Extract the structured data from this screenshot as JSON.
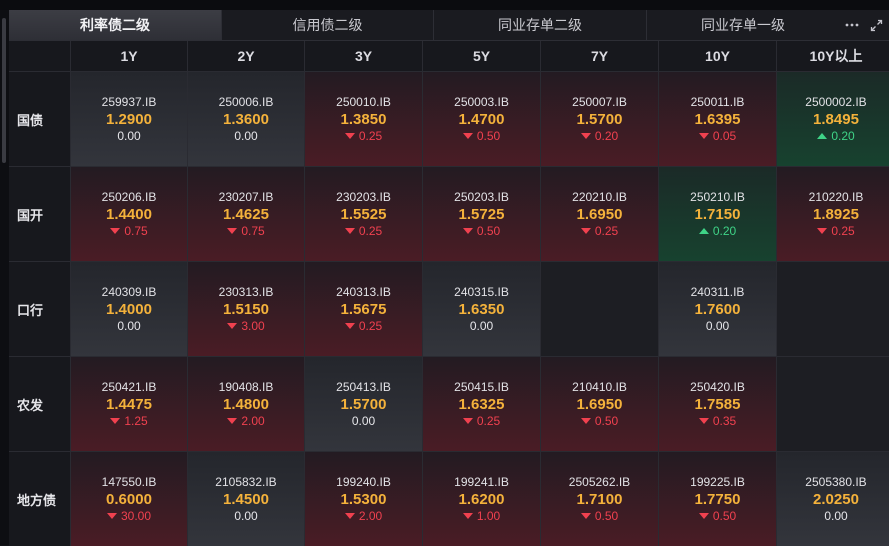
{
  "tabs": [
    "利率债二级",
    "信用债二级",
    "同业存单二级",
    "同业存单一级"
  ],
  "active_tab": 0,
  "icons": [
    "more-icon",
    "expand-icon"
  ],
  "columns": [
    "1Y",
    "2Y",
    "3Y",
    "5Y",
    "7Y",
    "10Y",
    "10Y以上"
  ],
  "rows": [
    {
      "label": "国债",
      "cells": [
        {
          "code": "259937.IB",
          "yield": "1.2900",
          "change": "0.00",
          "dir": "flat"
        },
        {
          "code": "250006.IB",
          "yield": "1.3600",
          "change": "0.00",
          "dir": "flat"
        },
        {
          "code": "250010.IB",
          "yield": "1.3850",
          "change": "0.25",
          "dir": "down"
        },
        {
          "code": "250003.IB",
          "yield": "1.4700",
          "change": "0.50",
          "dir": "down"
        },
        {
          "code": "250007.IB",
          "yield": "1.5700",
          "change": "0.20",
          "dir": "down"
        },
        {
          "code": "250011.IB",
          "yield": "1.6395",
          "change": "0.05",
          "dir": "down"
        },
        {
          "code": "2500002.IB",
          "yield": "1.8495",
          "change": "0.20",
          "dir": "up"
        }
      ]
    },
    {
      "label": "国开",
      "cells": [
        {
          "code": "250206.IB",
          "yield": "1.4400",
          "change": "0.75",
          "dir": "down"
        },
        {
          "code": "230207.IB",
          "yield": "1.4625",
          "change": "0.75",
          "dir": "down"
        },
        {
          "code": "230203.IB",
          "yield": "1.5525",
          "change": "0.25",
          "dir": "down"
        },
        {
          "code": "250203.IB",
          "yield": "1.5725",
          "change": "0.50",
          "dir": "down"
        },
        {
          "code": "220210.IB",
          "yield": "1.6950",
          "change": "0.25",
          "dir": "down"
        },
        {
          "code": "250210.IB",
          "yield": "1.7150",
          "change": "0.20",
          "dir": "up"
        },
        {
          "code": "210220.IB",
          "yield": "1.8925",
          "change": "0.25",
          "dir": "down"
        }
      ]
    },
    {
      "label": "口行",
      "cells": [
        {
          "code": "240309.IB",
          "yield": "1.4000",
          "change": "0.00",
          "dir": "flat"
        },
        {
          "code": "230313.IB",
          "yield": "1.5150",
          "change": "3.00",
          "dir": "down"
        },
        {
          "code": "240313.IB",
          "yield": "1.5675",
          "change": "0.25",
          "dir": "down"
        },
        {
          "code": "240315.IB",
          "yield": "1.6350",
          "change": "0.00",
          "dir": "flat"
        },
        null,
        {
          "code": "240311.IB",
          "yield": "1.7600",
          "change": "0.00",
          "dir": "flat"
        },
        null
      ]
    },
    {
      "label": "农发",
      "cells": [
        {
          "code": "250421.IB",
          "yield": "1.4475",
          "change": "1.25",
          "dir": "down"
        },
        {
          "code": "190408.IB",
          "yield": "1.4800",
          "change": "2.00",
          "dir": "down"
        },
        {
          "code": "250413.IB",
          "yield": "1.5700",
          "change": "0.00",
          "dir": "flat"
        },
        {
          "code": "250415.IB",
          "yield": "1.6325",
          "change": "0.25",
          "dir": "down"
        },
        {
          "code": "210410.IB",
          "yield": "1.6950",
          "change": "0.50",
          "dir": "down"
        },
        {
          "code": "250420.IB",
          "yield": "1.7585",
          "change": "0.35",
          "dir": "down"
        },
        null
      ]
    },
    {
      "label": "地方债",
      "cells": [
        {
          "code": "147550.IB",
          "yield": "0.6000",
          "change": "30.00",
          "dir": "down"
        },
        {
          "code": "2105832.IB",
          "yield": "1.4500",
          "change": "0.00",
          "dir": "flat"
        },
        {
          "code": "199240.IB",
          "yield": "1.5300",
          "change": "2.00",
          "dir": "down"
        },
        {
          "code": "199241.IB",
          "yield": "1.6200",
          "change": "1.00",
          "dir": "down"
        },
        {
          "code": "2505262.IB",
          "yield": "1.7100",
          "change": "0.50",
          "dir": "down"
        },
        {
          "code": "199225.IB",
          "yield": "1.7750",
          "change": "0.50",
          "dir": "down"
        },
        {
          "code": "2505380.IB",
          "yield": "2.0250",
          "change": "0.00",
          "dir": "flat"
        }
      ]
    }
  ],
  "colors": {
    "yield": "#f4b23b",
    "down": "#f0414f",
    "up": "#3fd387",
    "background": "#121318"
  }
}
